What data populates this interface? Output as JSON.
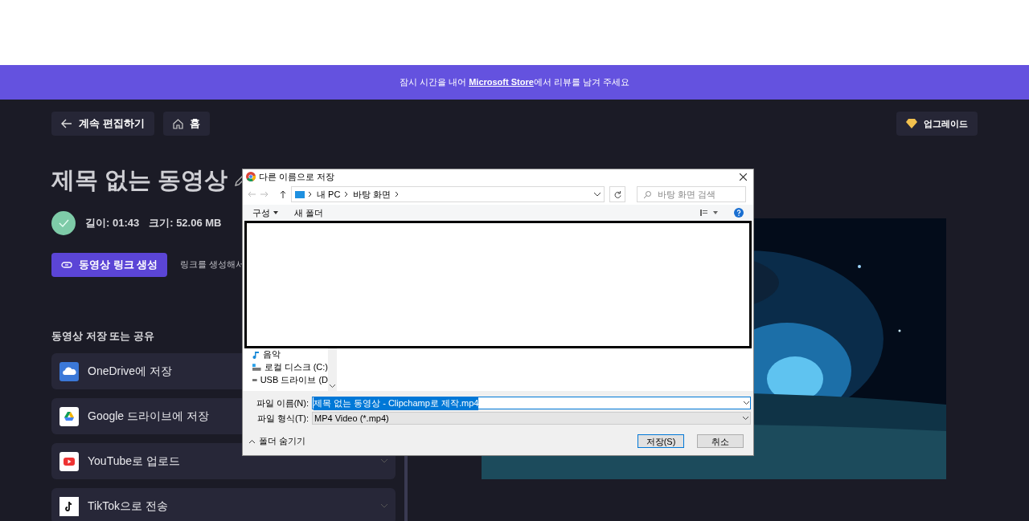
{
  "banner": {
    "text": "잠시 시간을 내어 ",
    "link": "Microsoft Store",
    "after": "에서 리뷰를 남겨 주세요"
  },
  "nav": {
    "back": "계속 편집하기",
    "home": "홈",
    "upgrade": "업그레이드"
  },
  "title": "제목 없는 동영상",
  "info": {
    "length": "길이: 01:43",
    "size": "크기: 52.06 MB"
  },
  "link_button": "동영상 링크 생성",
  "link_hint": "링크를 생성해서",
  "share_heading": "동영상 저장 또는 공유",
  "share_items": [
    {
      "kind": "onedrive",
      "label": "OneDrive에 저장"
    },
    {
      "kind": "gdrive",
      "label": "Google 드라이브에 저장"
    },
    {
      "kind": "youtube",
      "label": "YouTube로 업로드",
      "chevron": true
    },
    {
      "kind": "tiktok",
      "label": "TikTok으로 전송",
      "chevron": true
    }
  ],
  "dialog": {
    "title": "다른 이름으로 저장",
    "path": [
      "내 PC",
      "바탕 화면"
    ],
    "search_placeholder": "바탕 화면 검색",
    "organize": "구성",
    "new_folder": "새 폴더",
    "nav_items": [
      {
        "kind": "music",
        "label": "음악"
      },
      {
        "kind": "disk",
        "label": "로컬 디스크 (C:)"
      },
      {
        "kind": "usb",
        "label": "USB 드라이브 (D"
      }
    ],
    "filename_label": "파일 이름(N):",
    "filename": "제목 없는 동영상 - Clipchamp로 제작.mp4",
    "type_label": "파일 형식(T):",
    "type": "MP4 Video (*.mp4)",
    "hide_folders": "폴더 숨기기",
    "save": "저장(S)",
    "cancel": "취소"
  }
}
